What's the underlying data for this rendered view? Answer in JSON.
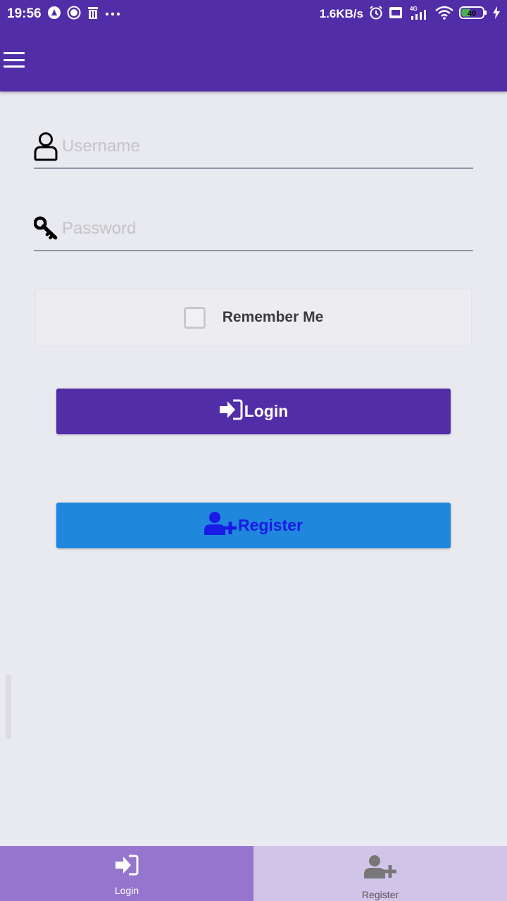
{
  "status_bar": {
    "time": "19:56",
    "net_speed": "1.6KB/s",
    "network": "4G",
    "battery": "40"
  },
  "form": {
    "username_placeholder": "Username",
    "password_placeholder": "Password",
    "remember_label": "Remember Me",
    "remember_checked": false
  },
  "buttons": {
    "login_label": "Login",
    "register_label": "Register"
  },
  "tabs": [
    {
      "label": "Login",
      "active": true
    },
    {
      "label": "Register",
      "active": false
    }
  ],
  "colors": {
    "primary": "#512da8",
    "register_button": "#1f88dd",
    "register_text": "#1a1ae6",
    "tab_active": "#9575cd",
    "tab_inactive": "#d1c4e9"
  }
}
